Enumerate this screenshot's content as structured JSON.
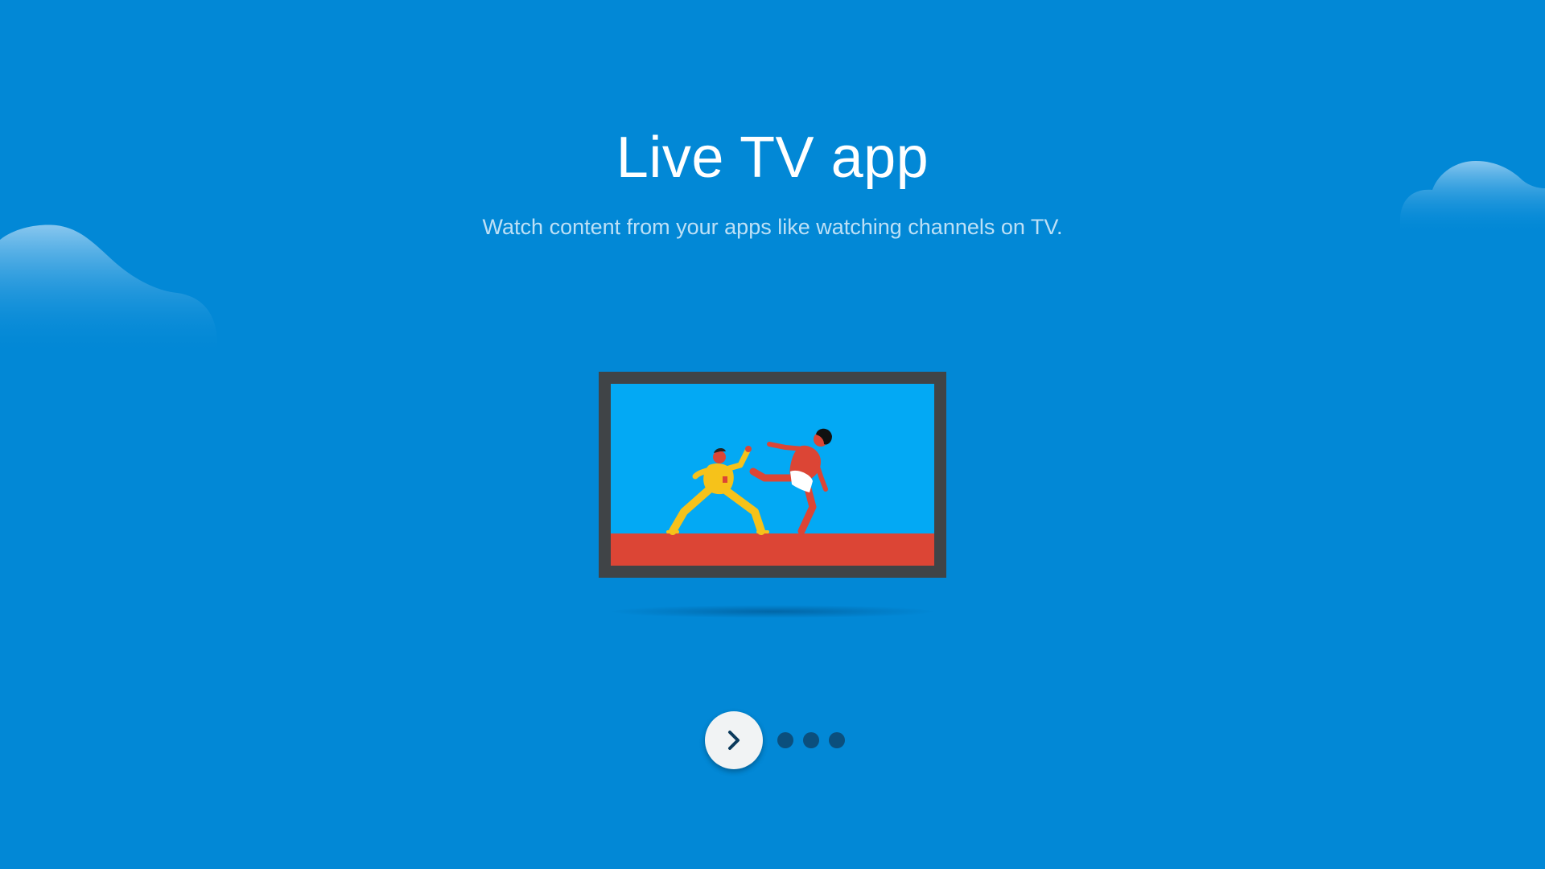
{
  "onboarding": {
    "title": "Live TV app",
    "description": "Watch content from your apps like watching channels on TV.",
    "next_icon": "chevron-right-icon",
    "page_indicator": {
      "total_dots": 3
    }
  },
  "colors": {
    "background": "#0288d6",
    "tv_frame": "#404447",
    "tv_screen": "#03a9f4",
    "tv_floor": "#dc4535",
    "fighter_yellow": "#f6c21a",
    "fighter_red": "#dc4535",
    "button_bg": "#f1f3f4",
    "chevron": "#0b3a5c",
    "dot": "#0b4f7d"
  }
}
